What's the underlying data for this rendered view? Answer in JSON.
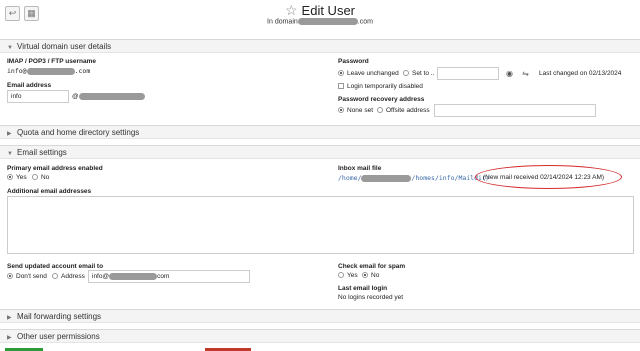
{
  "header": {
    "title": "Edit User",
    "subtitle_prefix": "In domain",
    "subtitle_suffix": ".com"
  },
  "toolbar": {
    "back_icon": "return-icon",
    "grid_icon": "grid-icon"
  },
  "sections": {
    "virtual": "Virtual domain user details",
    "quota": "Quota and home directory settings",
    "email": "Email settings",
    "forwarding": "Mail forwarding settings",
    "permissions": "Other user permissions"
  },
  "virtual": {
    "imap_label": "IMAP / POP3 / FTP username",
    "imap_prefix": "info@",
    "imap_suffix": ".com",
    "email_label": "Email address",
    "email_value": "info",
    "email_at": "@",
    "password_label": "Password",
    "pw_leave": "Leave unchanged",
    "pw_set": "Set to ..",
    "pw_changed": "Last changed on 02/13/2024",
    "login_disabled": "Login temporarily disabled",
    "recovery_label": "Password recovery address",
    "recovery_none": "None set",
    "recovery_offsite": "Offsite address"
  },
  "email": {
    "primary_label": "Primary email address enabled",
    "yes": "Yes",
    "no": "No",
    "inbox_label": "Inbox mail file",
    "inbox_prefix": "/home/",
    "inbox_suffix": "/homes/info/Maildir/",
    "inbox_status": "(New mail received 02/14/2024 12:23 AM)",
    "additional_label": "Additional email addresses",
    "send_label": "Send updated account email to",
    "dont_send": "Don't send",
    "address": "Address",
    "address_prefix": "info@",
    "address_suffix": "com",
    "spam_label": "Check email for spam",
    "spam_yes": "Yes",
    "spam_no": "No",
    "last_login_label": "Last email login",
    "last_login_value": "No logins recorded yet"
  },
  "colors": {
    "highlight_oval": "#d42b2b",
    "save_button": "#2e9a3a",
    "delete_button": "#c0392b"
  }
}
